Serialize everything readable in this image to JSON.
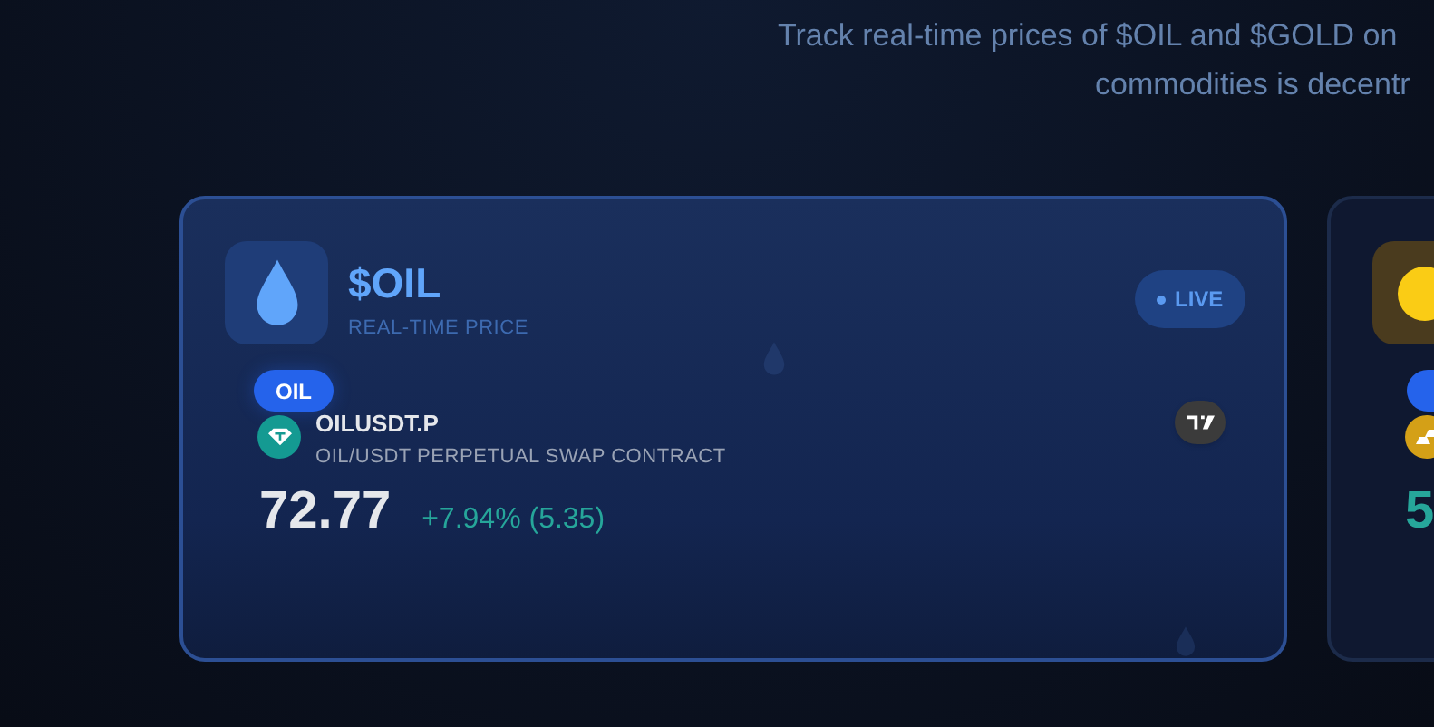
{
  "intro": [
    "Track real-time prices of $OIL and $GOLD on",
    "commodities is decentr"
  ],
  "cards": [
    {
      "kind": "oil",
      "symbol": "$OIL",
      "subtitle": "REAL-TIME PRICE",
      "live": "LIVE",
      "badge": "OIL",
      "ticker": "OILUSDT.P",
      "description": "OIL/USDT PERPETUAL SWAP CONTRACT",
      "price": "72.77",
      "change": "+7.94% (5.35)"
    },
    {
      "kind": "gold",
      "price": "5"
    }
  ]
}
